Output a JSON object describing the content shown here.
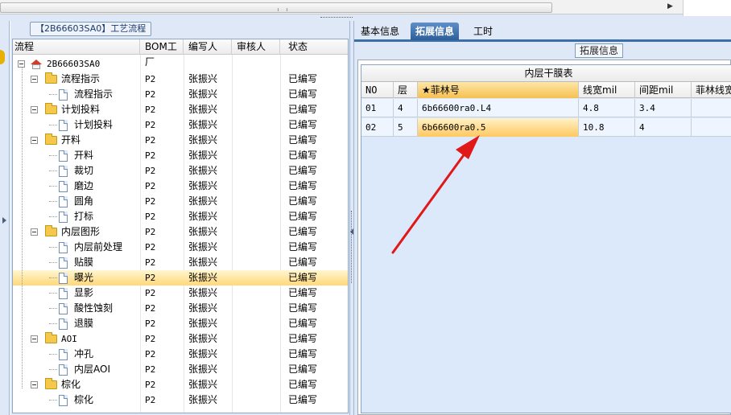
{
  "left_panel": {
    "title": "【2B66603SA0】工艺流程",
    "columns": [
      "流程",
      "BOM工厂",
      "编写人",
      "审核人",
      "状态"
    ],
    "rows": [
      {
        "label": "2B66603SA0",
        "bom": "",
        "author": "",
        "status": "",
        "type": "root"
      },
      {
        "label": "流程指示",
        "bom": "P2",
        "author": "张振兴",
        "status": "已编写",
        "type": "folder"
      },
      {
        "label": "流程指示",
        "bom": "P2",
        "author": "张振兴",
        "status": "已编写",
        "type": "doc"
      },
      {
        "label": "计划投料",
        "bom": "P2",
        "author": "张振兴",
        "status": "已编写",
        "type": "folder"
      },
      {
        "label": "计划投料",
        "bom": "P2",
        "author": "张振兴",
        "status": "已编写",
        "type": "doc"
      },
      {
        "label": "开料",
        "bom": "P2",
        "author": "张振兴",
        "status": "已编写",
        "type": "folder"
      },
      {
        "label": "开料",
        "bom": "P2",
        "author": "张振兴",
        "status": "已编写",
        "type": "doc"
      },
      {
        "label": "裁切",
        "bom": "P2",
        "author": "张振兴",
        "status": "已编写",
        "type": "doc"
      },
      {
        "label": "磨边",
        "bom": "P2",
        "author": "张振兴",
        "status": "已编写",
        "type": "doc"
      },
      {
        "label": "圆角",
        "bom": "P2",
        "author": "张振兴",
        "status": "已编写",
        "type": "doc"
      },
      {
        "label": "打标",
        "bom": "P2",
        "author": "张振兴",
        "status": "已编写",
        "type": "doc"
      },
      {
        "label": "内层图形",
        "bom": "P2",
        "author": "张振兴",
        "status": "已编写",
        "type": "folder"
      },
      {
        "label": "内层前处理",
        "bom": "P2",
        "author": "张振兴",
        "status": "已编写",
        "type": "doc"
      },
      {
        "label": "贴膜",
        "bom": "P2",
        "author": "张振兴",
        "status": "已编写",
        "type": "doc"
      },
      {
        "label": "曝光",
        "bom": "P2",
        "author": "张振兴",
        "status": "已编写",
        "type": "doc",
        "selected": true
      },
      {
        "label": "显影",
        "bom": "P2",
        "author": "张振兴",
        "status": "已编写",
        "type": "doc"
      },
      {
        "label": "酸性蚀刻",
        "bom": "P2",
        "author": "张振兴",
        "status": "已编写",
        "type": "doc"
      },
      {
        "label": "退膜",
        "bom": "P2",
        "author": "张振兴",
        "status": "已编写",
        "type": "doc"
      },
      {
        "label": "AOI",
        "bom": "P2",
        "author": "张振兴",
        "status": "已编写",
        "type": "folder"
      },
      {
        "label": "冲孔",
        "bom": "P2",
        "author": "张振兴",
        "status": "已编写",
        "type": "doc"
      },
      {
        "label": "内层AOI",
        "bom": "P2",
        "author": "张振兴",
        "status": "已编写",
        "type": "doc"
      },
      {
        "label": "棕化",
        "bom": "P2",
        "author": "张振兴",
        "status": "已编写",
        "type": "folder"
      },
      {
        "label": "棕化",
        "bom": "P2",
        "author": "张振兴",
        "status": "已编写",
        "type": "doc"
      }
    ]
  },
  "right_panel": {
    "tabs": [
      {
        "label": "基本信息",
        "active": false
      },
      {
        "label": "拓展信息",
        "active": true
      },
      {
        "label": "工时",
        "active": false
      }
    ],
    "section_title": "拓展信息",
    "grid_title": "内层干膜表",
    "columns": [
      "NO",
      "层",
      "★菲林号",
      "线宽mil",
      "间距mil",
      "菲林线宽"
    ],
    "rows": [
      [
        "01",
        "4",
        "6b66600ra0.L4",
        "4.8",
        "3.4",
        ""
      ],
      [
        "02",
        "5",
        "6b66600ra0.5",
        "10.8",
        "4",
        ""
      ]
    ]
  },
  "colors": {
    "selection": "#ffd87a",
    "tab_active": "#2f5f98",
    "annotation_arrow": "#e01818"
  }
}
